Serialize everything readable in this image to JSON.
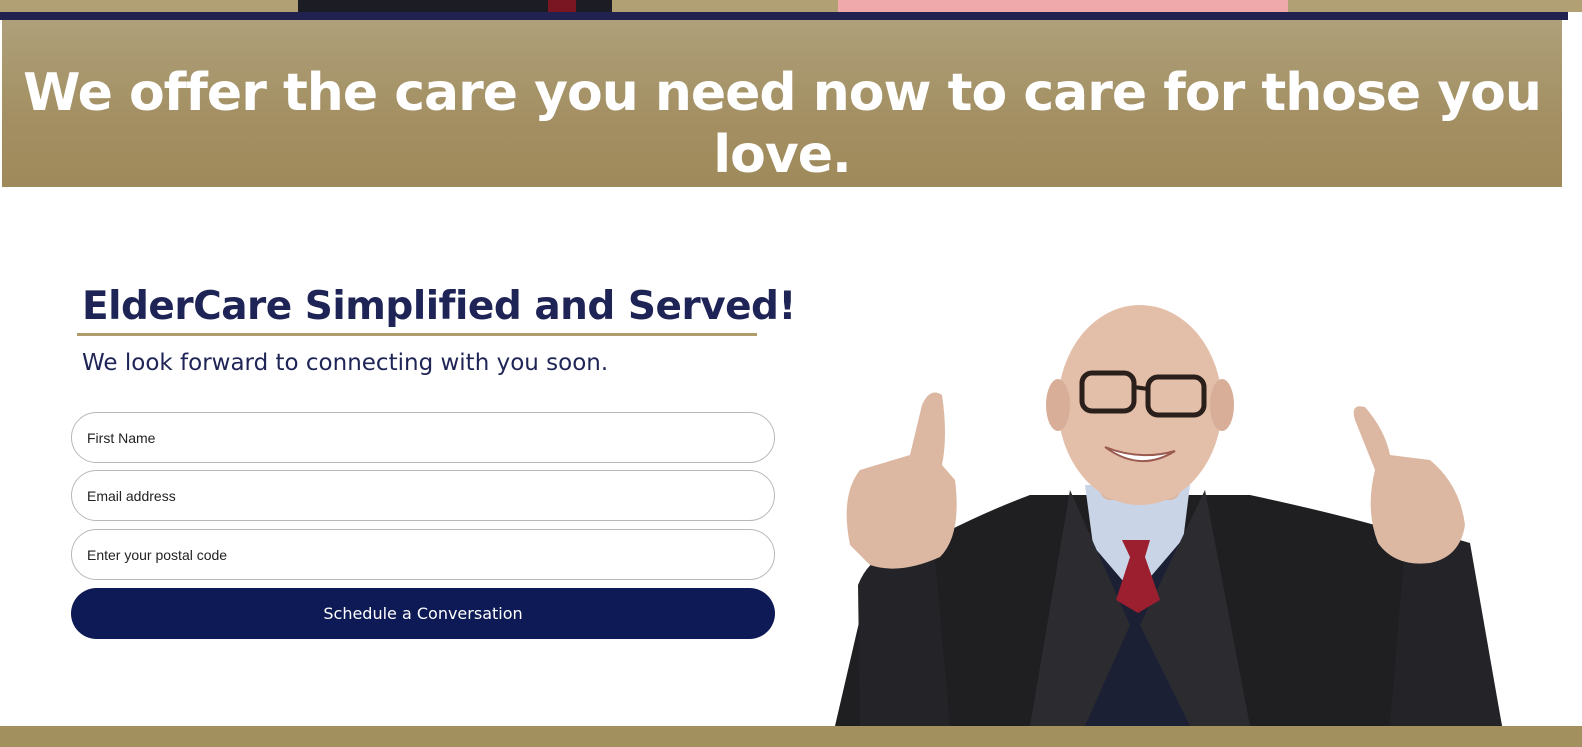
{
  "banner": {
    "headline": "We offer the care you need now to care for those you love."
  },
  "intro": {
    "heading": "ElderCare Simplified and Served!",
    "subheading": "We look forward to connecting with you soon."
  },
  "form": {
    "first_name": {
      "value": "",
      "placeholder": "First Name"
    },
    "email": {
      "value": "",
      "placeholder": "Email address"
    },
    "postal_code": {
      "value": "",
      "placeholder": "Enter your postal code"
    },
    "submit_label": "Schedule a Conversation"
  },
  "hero_image": {
    "icon": "elderly-man-thumbs-up-photo"
  },
  "colors": {
    "navy": "#0d1a55",
    "heading_navy": "#1f2456",
    "gold": "#a38f62",
    "gold_rule": "#b09d6c"
  }
}
